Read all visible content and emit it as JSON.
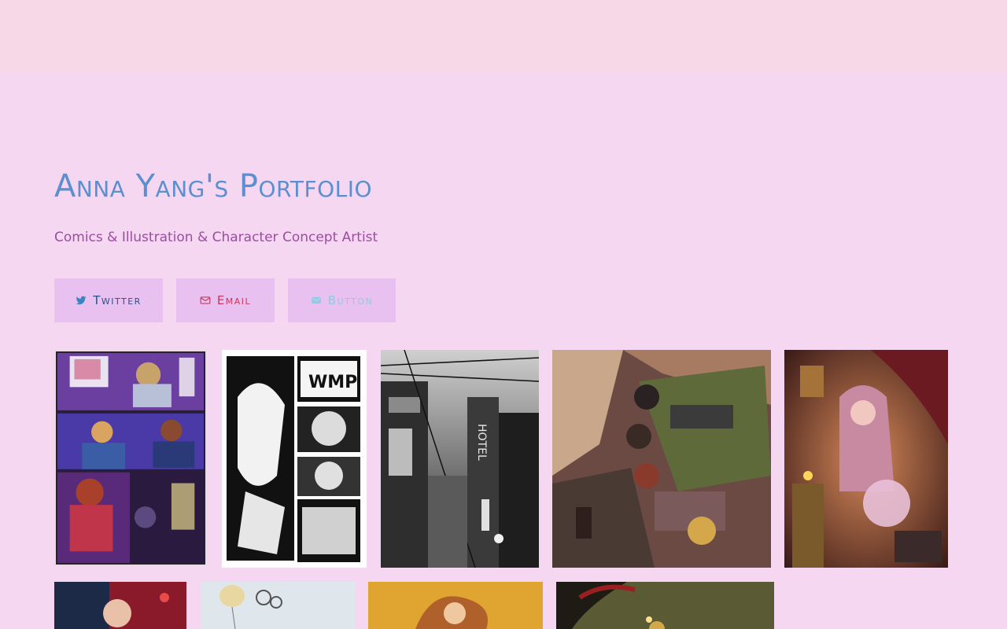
{
  "header": {
    "title": "Anna Yang's Portfolio",
    "subtitle": "Comics & Illustration & Character Concept Artist"
  },
  "buttons": {
    "twitter": {
      "label": "Twitter",
      "icon": "twitter-icon"
    },
    "email": {
      "label": "Email",
      "icon": "envelope-icon"
    },
    "other": {
      "label": "Button",
      "icon": "envelope-icon"
    }
  },
  "colors": {
    "page_background": "#f6d7f1",
    "top_bar": "#f6d8e6",
    "title": "#5b8fd0",
    "subtitle": "#9a4ea0",
    "button_background": "#e8c1f1"
  },
  "gallery": [
    {
      "name": "color-comic-page"
    },
    {
      "name": "ink-comic-page"
    },
    {
      "name": "city-street-hotel"
    },
    {
      "name": "friends-on-couch"
    },
    {
      "name": "fortune-teller"
    },
    {
      "name": "red-portrait"
    },
    {
      "name": "balloon-sketch"
    },
    {
      "name": "orange-character"
    },
    {
      "name": "dark-scythe"
    }
  ]
}
